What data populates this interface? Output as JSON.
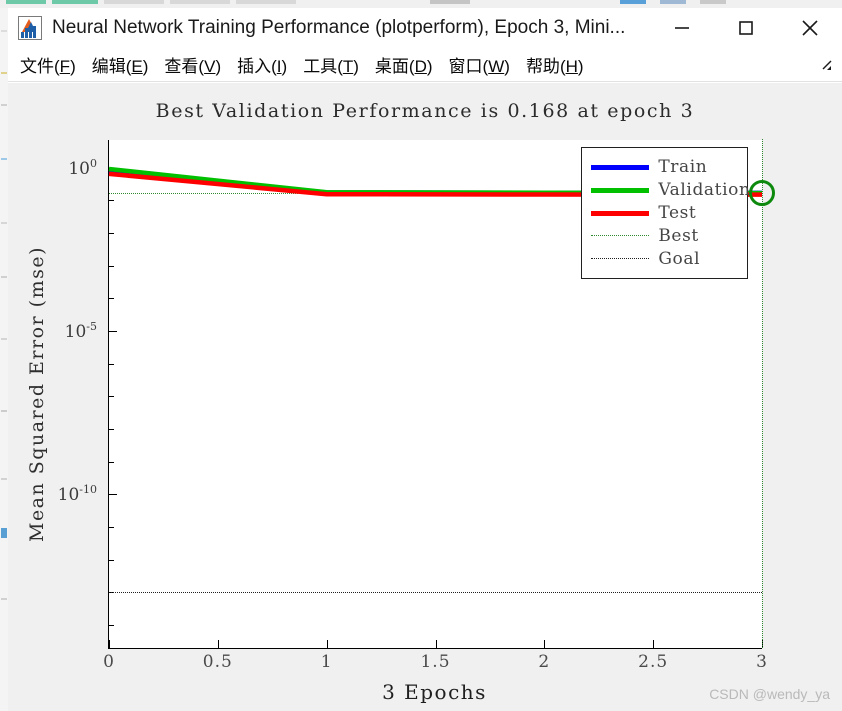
{
  "window": {
    "title": "Neural Network Training Performance (plotperform), Epoch 3, Mini...",
    "icon": "matlab-figure-icon",
    "buttons": {
      "minimize": "minimize-icon",
      "maximize": "maximize-icon",
      "close": "close-icon"
    }
  },
  "menubar": {
    "items": [
      {
        "label": "文件",
        "accel": "F"
      },
      {
        "label": "编辑",
        "accel": "E"
      },
      {
        "label": "查看",
        "accel": "V"
      },
      {
        "label": "插入",
        "accel": "I"
      },
      {
        "label": "工具",
        "accel": "T"
      },
      {
        "label": "桌面",
        "accel": "D"
      },
      {
        "label": "窗口",
        "accel": "W"
      },
      {
        "label": "帮助",
        "accel": "H"
      }
    ],
    "corner_icon": "dock-arrow-icon"
  },
  "watermark": "CSDN @wendy_ya",
  "chart_data": {
    "type": "line",
    "title": "Best Validation Performance is 0.168 at epoch 3",
    "xlabel": "3 Epochs",
    "ylabel": "Mean Squared Error  (mse)",
    "xlim": [
      0,
      3
    ],
    "xticks": [
      "0",
      "0.5",
      "1",
      "1.5",
      "2",
      "2.5",
      "3"
    ],
    "xtick_values": [
      0,
      0.5,
      1,
      1.5,
      2,
      2.5,
      3
    ],
    "yscale": "log",
    "ylim_exponent": [
      -14.7,
      0.85
    ],
    "yticks": [
      {
        "label": "10",
        "exponent": "0",
        "value": 1
      },
      {
        "label": "10",
        "exponent": "-5",
        "value": 1e-05
      },
      {
        "label": "10",
        "exponent": "-10",
        "value": 1e-10
      }
    ],
    "grid": false,
    "x": [
      0,
      1,
      2,
      3
    ],
    "series": [
      {
        "name": "Train",
        "color": "#0000ff",
        "values": [
          0.78,
          0.175,
          0.172,
          0.17
        ]
      },
      {
        "name": "Validation",
        "color": "#00c000",
        "values": [
          0.92,
          0.178,
          0.172,
          0.168
        ]
      },
      {
        "name": "Test",
        "color": "#ff0000",
        "values": [
          0.65,
          0.155,
          0.152,
          0.15
        ]
      }
    ],
    "best": {
      "label": "Best",
      "color": "#2f8a2f",
      "value": 0.168,
      "epoch": 3,
      "marker": "best-validation-circle"
    },
    "goal": {
      "label": "Goal",
      "color": "#202020",
      "value": 1e-13
    },
    "legend": {
      "position": "top-right",
      "entries": [
        {
          "label": "Train",
          "color": "#0000ff",
          "style": "solid"
        },
        {
          "label": "Validation",
          "color": "#00c000",
          "style": "solid"
        },
        {
          "label": "Test",
          "color": "#ff0000",
          "style": "solid"
        },
        {
          "label": "Best",
          "color": "#2f8a2f",
          "style": "dotted"
        },
        {
          "label": "Goal",
          "color": "#202020",
          "style": "dotted"
        }
      ]
    }
  }
}
